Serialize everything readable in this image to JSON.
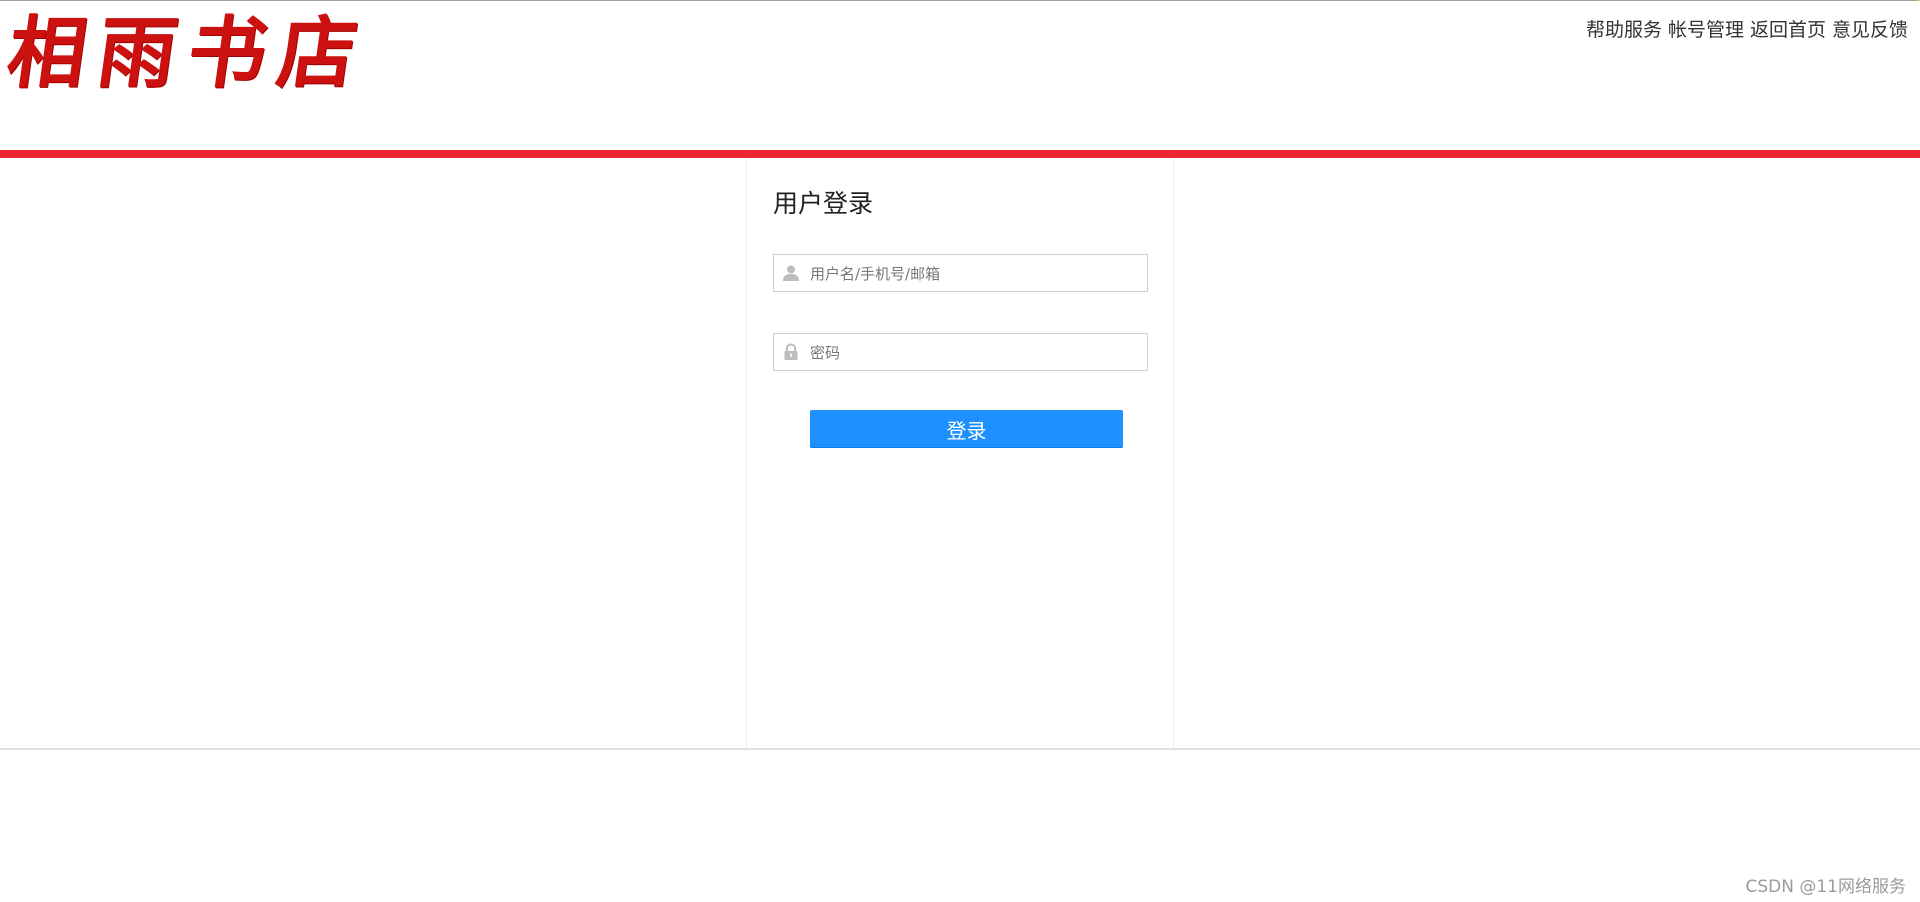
{
  "header": {
    "logo_text": "相雨书店",
    "nav": [
      {
        "label": "帮助服务"
      },
      {
        "label": "帐号管理"
      },
      {
        "label": "返回首页"
      },
      {
        "label": "意见反馈"
      }
    ]
  },
  "login": {
    "title": "用户登录",
    "username_placeholder": "用户名/手机号/邮箱",
    "password_placeholder": "密码",
    "submit_label": "登录"
  },
  "footer": {
    "watermark": "CSDN @11网络服务"
  },
  "colors": {
    "brand_red": "#cc1111",
    "divider_red": "#ee2533",
    "button_blue": "#1e90ff"
  }
}
